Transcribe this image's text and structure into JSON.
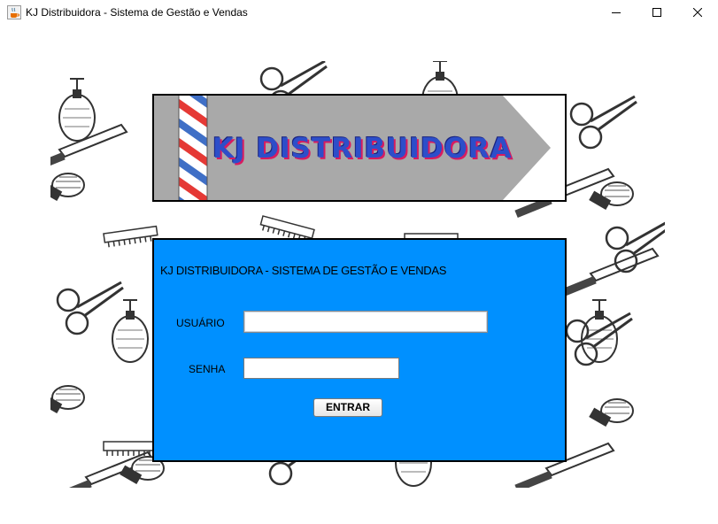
{
  "window": {
    "title": "KJ Distribuidora - Sistema de Gestão e Vendas",
    "app_icon": "java-cup-icon",
    "controls": [
      "minimize-icon",
      "maximize-icon",
      "close-icon"
    ]
  },
  "banner": {
    "text": "KJ DISTRIBUIDORA",
    "pole_colors": [
      "#e53935",
      "#ffffff",
      "#3f6fc6"
    ],
    "arrow_color": "#a9a9a9"
  },
  "login": {
    "panel_color": "#0090ff",
    "heading": "KJ DISTRIBUIDORA - SISTEMA DE GESTÃO E VENDAS",
    "user_label": "USUÁRIO",
    "user_value": "",
    "password_label": "SENHA",
    "password_value": "",
    "submit_label": "ENTRAR"
  },
  "background": {
    "pattern": "barber-tools-sketch"
  }
}
